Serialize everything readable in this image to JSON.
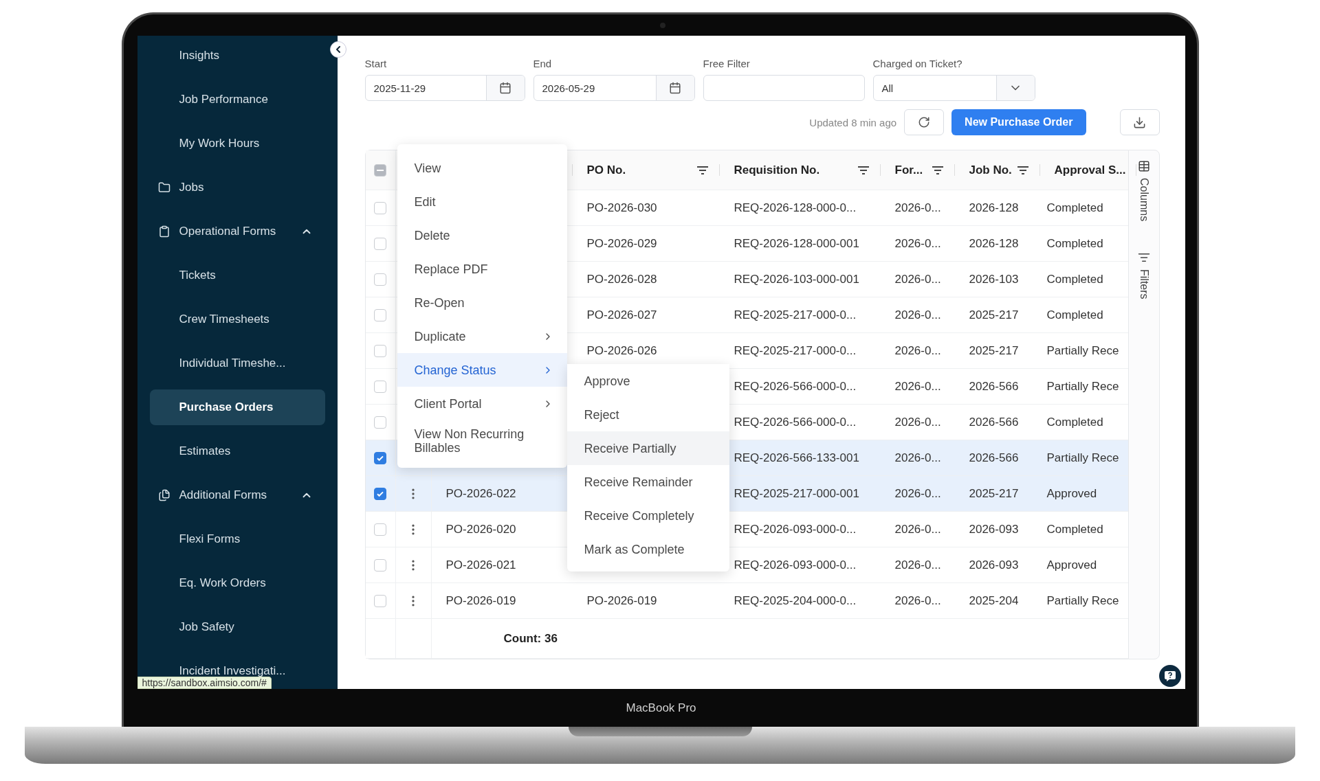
{
  "device": {
    "label": "MacBook Pro"
  },
  "sidebar": {
    "items": [
      {
        "kind": "link",
        "label": "Insights",
        "selected": false
      },
      {
        "kind": "link",
        "label": "Job Performance",
        "selected": false
      },
      {
        "kind": "link",
        "label": "My Work Hours",
        "selected": false
      },
      {
        "kind": "folder",
        "label": "Jobs",
        "selected": false
      },
      {
        "kind": "forms",
        "label": "Operational Forms",
        "selected": false,
        "expanded": true,
        "children": [
          {
            "kind": "link",
            "label": "Tickets",
            "selected": false
          },
          {
            "kind": "link",
            "label": "Crew Timesheets",
            "selected": false
          },
          {
            "kind": "link",
            "label": "Individual Timeshe...",
            "selected": false
          },
          {
            "kind": "link",
            "label": "Purchase Orders",
            "selected": true
          },
          {
            "kind": "link",
            "label": "Estimates",
            "selected": false
          }
        ]
      },
      {
        "kind": "files",
        "label": "Additional Forms",
        "selected": false,
        "expanded": true,
        "children": [
          {
            "kind": "link",
            "label": "Flexi Forms",
            "selected": false
          },
          {
            "kind": "link",
            "label": "Eq. Work Orders",
            "selected": false
          },
          {
            "kind": "link",
            "label": "Job Safety",
            "selected": false
          },
          {
            "kind": "link",
            "label": "Incident Investigati...",
            "selected": false
          }
        ]
      }
    ]
  },
  "status_url": "https://sandbox.aimsio.com/#",
  "filters": {
    "start": {
      "label": "Start",
      "value": "2025-11-29"
    },
    "end": {
      "label": "End",
      "value": "2026-05-29"
    },
    "free_filter": {
      "label": "Free Filter"
    },
    "charged_on_ticket": {
      "label": "Charged on Ticket?",
      "value": "All"
    }
  },
  "toolbar": {
    "updated": "Updated 8 min ago",
    "new_button": "New Purchase Order"
  },
  "table": {
    "select_all_indeterminate": true,
    "columns": [
      {
        "label": "PO No.",
        "filter": true
      },
      {
        "label": "Requisition No.",
        "filter": true
      },
      {
        "label": "For...",
        "filter": true
      },
      {
        "label": "Job No.",
        "filter": true
      },
      {
        "label": "Approval S...",
        "filter": false
      }
    ],
    "rows": [
      {
        "selected": false,
        "po_no": "PO-2026-030",
        "requisition_no": "REQ-2026-128-000-0...",
        "column_5": "2026-0...",
        "job_no": "2026-128",
        "column_7": "Completed"
      },
      {
        "selected": false,
        "po_no": "PO-2026-029",
        "requisition_no": "REQ-2026-128-000-001",
        "column_5": "2026-0...",
        "job_no": "2026-128",
        "column_7": "Completed"
      },
      {
        "selected": false,
        "po_no": "PO-2026-028",
        "requisition_no": "REQ-2026-103-000-001",
        "column_5": "2026-0...",
        "job_no": "2026-103",
        "column_7": "Completed"
      },
      {
        "selected": false,
        "po_no": "PO-2026-027",
        "requisition_no": "REQ-2025-217-000-0...",
        "column_5": "2026-0...",
        "job_no": "2025-217",
        "column_7": "Completed"
      },
      {
        "selected": false,
        "po_no": "PO-2026-026",
        "requisition_no": "REQ-2025-217-000-0...",
        "column_5": "2026-0...",
        "job_no": "2025-217",
        "column_7": "Partially Rece"
      },
      {
        "selected": false,
        "requisition_no": "REQ-2026-566-000-0...",
        "column_5": "2026-0...",
        "job_no": "2026-566",
        "column_7": "Partially Rece"
      },
      {
        "selected": false,
        "requisition_no": "REQ-2026-566-000-0...",
        "column_5": "2026-0...",
        "job_no": "2026-566",
        "column_7": "Completed"
      },
      {
        "selected": true,
        "requisition_no": "REQ-2026-566-133-001",
        "column_5": "2026-0...",
        "job_no": "2026-566",
        "column_7": "Partially Rece"
      },
      {
        "selected": true,
        "column_3": "PO-2026-022",
        "requisition_no": "REQ-2025-217-000-001",
        "column_5": "2026-0...",
        "job_no": "2025-217",
        "column_7": "Approved"
      },
      {
        "selected": false,
        "column_3": "PO-2026-020",
        "requisition_no": "REQ-2026-093-000-0...",
        "column_5": "2026-0...",
        "job_no": "2026-093",
        "column_7": "Completed"
      },
      {
        "selected": false,
        "column_3": "PO-2026-021",
        "requisition_no": "REQ-2026-093-000-0...",
        "column_5": "2026-0...",
        "job_no": "2026-093",
        "column_7": "Approved"
      },
      {
        "selected": false,
        "column_3": "PO-2026-019",
        "po_no": "PO-2026-019",
        "requisition_no": "REQ-2025-204-000-0...",
        "column_5": "2026-0...",
        "job_no": "2025-204",
        "column_7": "Partially Rece"
      }
    ],
    "count": "Count: 36"
  },
  "side_panel": [
    {
      "kind": "columns",
      "label": "Columns"
    },
    {
      "kind": "filters",
      "label": "Filters"
    }
  ],
  "context_menu": {
    "items": [
      {
        "kind": "action",
        "label": "View",
        "highlighted": false
      },
      {
        "kind": "action",
        "label": "Edit",
        "highlighted": false
      },
      {
        "kind": "action",
        "label": "Delete",
        "highlighted": false
      },
      {
        "kind": "action",
        "label": "Replace PDF",
        "highlighted": false
      },
      {
        "kind": "action",
        "label": "Re-Open",
        "highlighted": false
      },
      {
        "kind": "submenu",
        "label": "Duplicate",
        "highlighted": false
      },
      {
        "kind": "submenu",
        "label": "Change Status",
        "highlighted": true
      },
      {
        "kind": "submenu",
        "label": "Client Portal",
        "highlighted": false
      },
      {
        "kind": "action",
        "label": "View Non Recurring Billables",
        "highlighted": false
      }
    ],
    "submenu": {
      "items": [
        {
          "label": "Approve",
          "highlighted": false
        },
        {
          "label": "Reject",
          "highlighted": false
        },
        {
          "label": "Receive Partially",
          "highlighted": true
        },
        {
          "label": "Receive Remainder",
          "highlighted": false
        },
        {
          "label": "Receive Completely",
          "highlighted": false
        },
        {
          "label": "Mark as Complete",
          "highlighted": false
        }
      ]
    }
  }
}
